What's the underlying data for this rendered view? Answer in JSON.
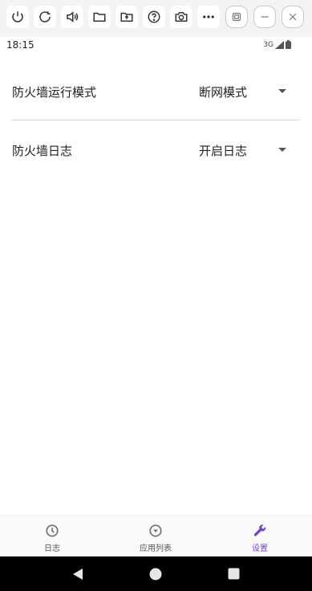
{
  "status_bar": {
    "time": "18:15",
    "network": "3G"
  },
  "settings": [
    {
      "label": "防火墙运行模式",
      "value": "断网模式"
    },
    {
      "label": "防火墙日志",
      "value": "开启日志"
    }
  ],
  "bottom_nav": {
    "items": [
      {
        "label": "日志",
        "icon": "clock-icon"
      },
      {
        "label": "应用列表",
        "icon": "chevron-circle-icon"
      },
      {
        "label": "设置",
        "icon": "wrench-icon"
      }
    ],
    "active_index": 2
  },
  "colors": {
    "accent": "#7b3fd0",
    "toolbar_bg": "#f3f3f3"
  }
}
